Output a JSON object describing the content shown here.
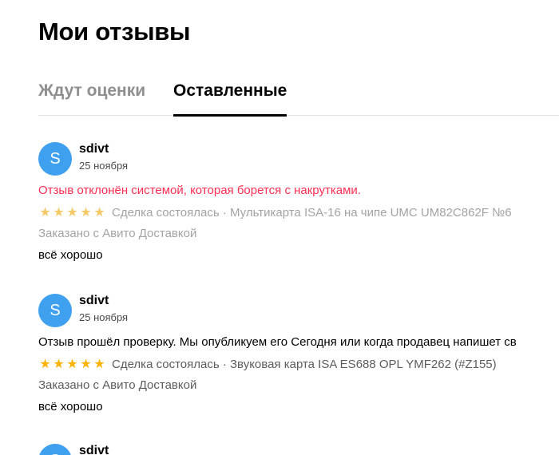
{
  "page": {
    "title": "Мои отзывы"
  },
  "tabs": [
    {
      "label": "Ждут оценки",
      "active": false
    },
    {
      "label": "Оставленные",
      "active": true
    }
  ],
  "colors": {
    "avatar": "#3fa0f0",
    "rejected_text": "#ff2e52",
    "star_muted": "#f5c96a",
    "star_active": "#ffb300",
    "active_tab_underline": "#000000"
  },
  "reviews": [
    {
      "avatar_letter": "S",
      "username": "sdivt",
      "date": "25 ноября",
      "status": "Отзыв отклонён системой, которая борется с накрутками.",
      "status_type": "rejected",
      "rating": 5,
      "deal": "Сделка состоялась · Мультикарта ISA-16 на чипе UMC UM82C862F №6",
      "delivery": "Заказано с Авито Доставкой",
      "comment": "всё хорошо"
    },
    {
      "avatar_letter": "S",
      "username": "sdivt",
      "date": "25 ноября",
      "status": "Отзыв прошёл проверку. Мы опубликуем его Сегодня или когда продавец напишет св",
      "status_type": "accepted",
      "rating": 5,
      "deal": "Сделка состоялась · Звуковая карта ISA ES688 OPL YMF262 (#Z155)",
      "delivery": "Заказано с Авито Доставкой",
      "comment": "всё хорошо"
    },
    {
      "avatar_letter": "S",
      "username": "sdivt"
    }
  ],
  "icons": {
    "star": "star-icon"
  }
}
